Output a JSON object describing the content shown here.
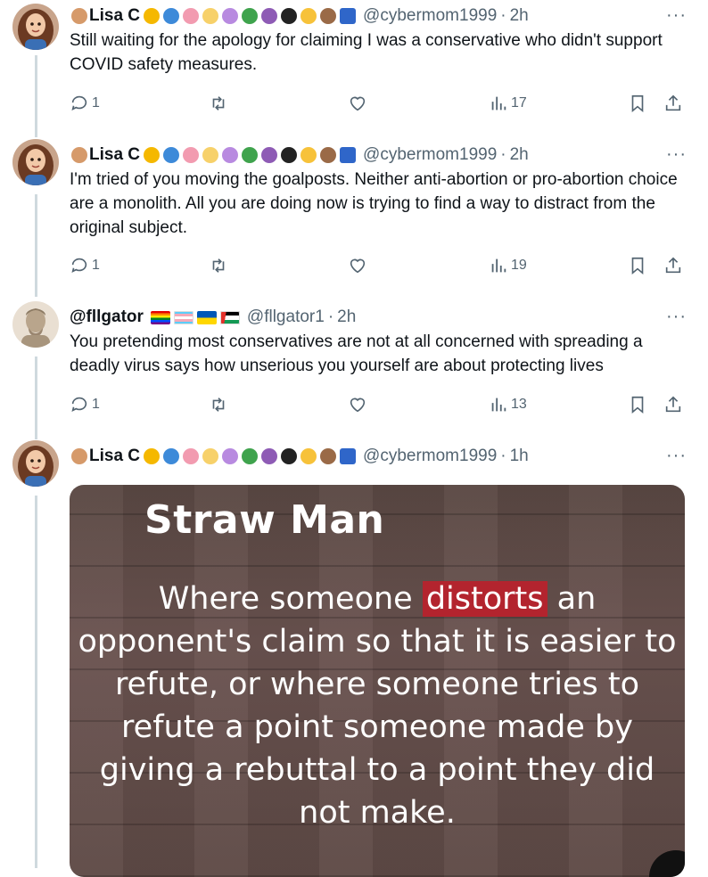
{
  "tweets": [
    {
      "name": "Lisa C",
      "handle": "@cybermom1999",
      "sep": "·",
      "time": "2h",
      "text": "Still waiting for the apology for claiming I was a conservative who didn't support COVID safety measures.",
      "replies": "1",
      "retweets": "",
      "likes": "",
      "views": "17"
    },
    {
      "name": "Lisa C",
      "handle": "@cybermom1999",
      "sep": "·",
      "time": "2h",
      "text": "I'm tried of you moving the goalposts. Neither anti-abortion or pro-abortion choice are a monolith. All you are doing now is trying to find a way to distract from the original subject.",
      "replies": "1",
      "retweets": "",
      "likes": "",
      "views": "19"
    },
    {
      "name": "@fllgator",
      "handle": "@fllgator1",
      "sep": "·",
      "time": "2h",
      "text": "You pretending most conservatives are not at all concerned with spreading a deadly virus says how unserious you yourself are about protecting lives",
      "replies": "1",
      "retweets": "",
      "likes": "",
      "views": "13"
    },
    {
      "name": "Lisa C",
      "handle": "@cybermom1999",
      "sep": "·",
      "time": "1h",
      "card": {
        "title": "Straw Man",
        "body_before": "Where someone ",
        "highlight": "distorts",
        "body_after": " an opponent's claim so that it is easier to refute, or where someone tries to refute a point someone made by giving a rebuttal to a point they did not make."
      }
    }
  ],
  "more_label": "···",
  "colors": {
    "secondary_text": "#536471",
    "thread_line": "#cfd9de",
    "highlight": "#b3242e"
  },
  "icons": [
    "reply-icon",
    "retweet-icon",
    "like-icon",
    "views-icon",
    "bookmark-icon",
    "share-icon"
  ]
}
